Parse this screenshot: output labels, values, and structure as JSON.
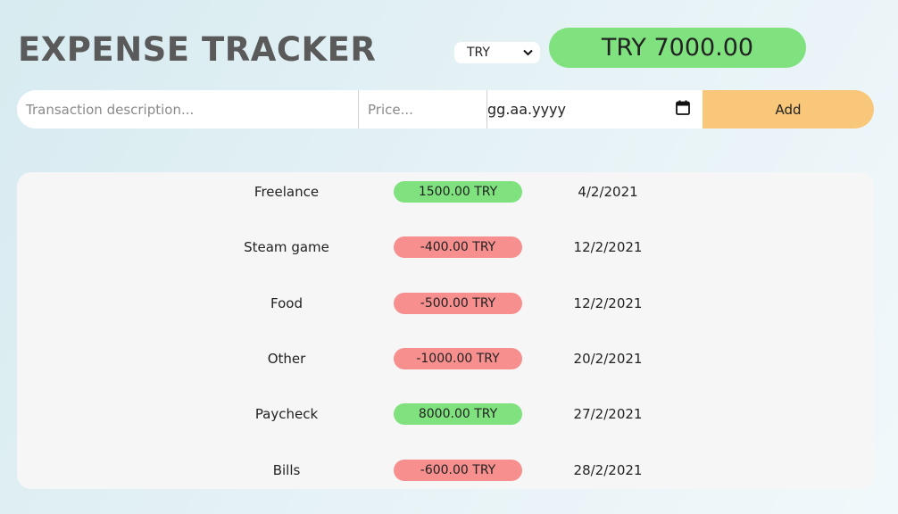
{
  "header": {
    "title": "EXPENSE TRACKER",
    "currency": "TRY",
    "balance": "TRY 7000.00"
  },
  "form": {
    "description_placeholder": "Transaction description...",
    "price_placeholder": "Price...",
    "date_placeholder": "gg.aa.yyyy",
    "add_label": "Add"
  },
  "colors": {
    "income": "#7fe27f",
    "expense": "#f78f8f",
    "add_button": "#f8c77a",
    "title": "#5a5a5a"
  },
  "transactions": [
    {
      "description": "Freelance",
      "amount": "1500.00 TRY",
      "date": "4/2/2021",
      "type": "income"
    },
    {
      "description": "Steam game",
      "amount": "-400.00 TRY",
      "date": "12/2/2021",
      "type": "expense"
    },
    {
      "description": "Food",
      "amount": "-500.00 TRY",
      "date": "12/2/2021",
      "type": "expense"
    },
    {
      "description": "Other",
      "amount": "-1000.00 TRY",
      "date": "20/2/2021",
      "type": "expense"
    },
    {
      "description": "Paycheck",
      "amount": "8000.00 TRY",
      "date": "27/2/2021",
      "type": "income"
    },
    {
      "description": "Bills",
      "amount": "-600.00 TRY",
      "date": "28/2/2021",
      "type": "expense"
    }
  ]
}
